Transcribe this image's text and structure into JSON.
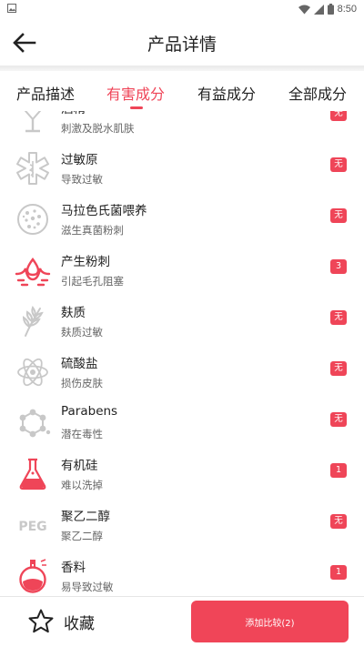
{
  "status_bar": {
    "time": "8:50",
    "icons": [
      "image-icon",
      "wifi-icon",
      "signal-icon",
      "battery-icon"
    ]
  },
  "header": {
    "title": "产品详情",
    "back_icon": "arrow-left-icon"
  },
  "tabs": [
    {
      "label": "产品描述",
      "active": false
    },
    {
      "label": "有害成分",
      "active": true
    },
    {
      "label": "有益成分",
      "active": false
    },
    {
      "label": "全部成分",
      "active": false
    }
  ],
  "ingredients": [
    {
      "name": "酒精",
      "desc": "刺激及脱水肌肤",
      "badge": "无",
      "icon": "cocktail-glass-icon"
    },
    {
      "name": "过敏原",
      "desc": "导致过敏",
      "badge": "无",
      "icon": "medical-star-icon"
    },
    {
      "name": "马拉色氏菌喂养",
      "desc": "滋生真菌粉刺",
      "badge": "无",
      "icon": "bacteria-icon"
    },
    {
      "name": "产生粉刺",
      "desc": "引起毛孔阻塞",
      "badge": "3",
      "icon": "pore-drop-icon"
    },
    {
      "name": "麸质",
      "desc": "麸质过敏",
      "badge": "无",
      "icon": "wheat-icon"
    },
    {
      "name": "硫酸盐",
      "desc": "损伤皮肤",
      "badge": "无",
      "icon": "atom-icon"
    },
    {
      "name": "Parabens",
      "desc": "潜在毒性",
      "badge": "无",
      "icon": "molecule-icon"
    },
    {
      "name": "有机硅",
      "desc": "难以洗掉",
      "badge": "1",
      "icon": "flask-icon"
    },
    {
      "name": "聚乙二醇",
      "desc": "聚乙二醇",
      "badge": "无",
      "icon": "peg-icon",
      "icon_text": "PEG"
    },
    {
      "name": "香料",
      "desc": "易导致过敏",
      "badge": "1",
      "icon": "perfume-icon"
    }
  ],
  "bottom": {
    "favorite_label": "收藏",
    "compare_label": "添加比较(2)"
  },
  "colors": {
    "accent": "#ef4558",
    "icon_gray": "#c8c8c8",
    "text": "#222222",
    "subtext": "#666666"
  }
}
